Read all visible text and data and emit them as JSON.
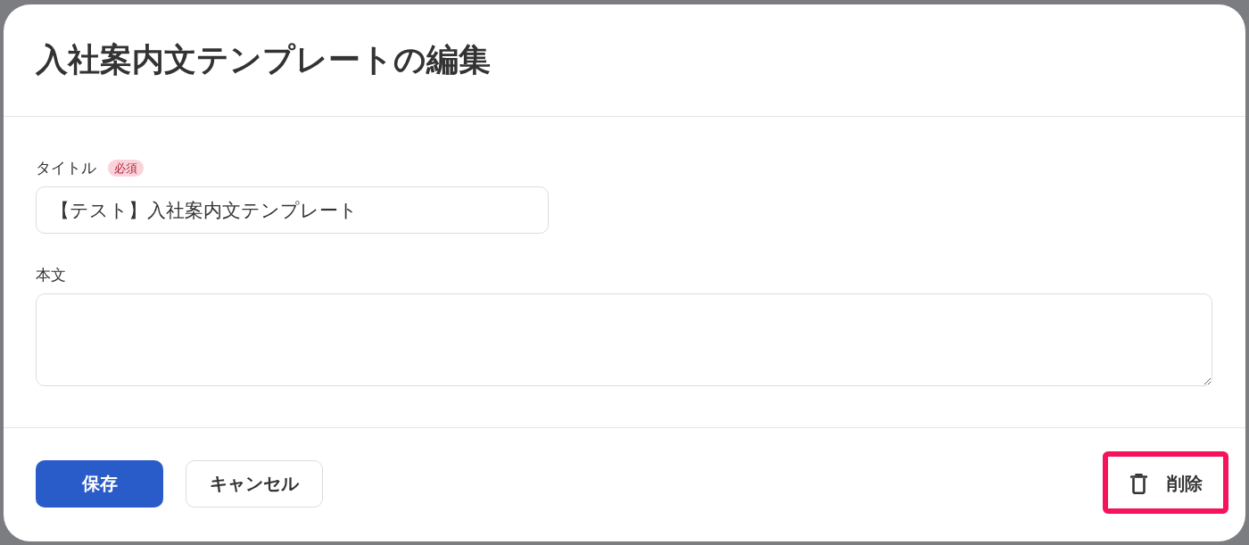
{
  "dialog": {
    "title": "入社案内文テンプレートの編集"
  },
  "fields": [
    {
      "kind": "input",
      "label": "タイトル",
      "badge": "必須",
      "value": "【テスト】入社案内文テンプレート"
    },
    {
      "kind": "textarea",
      "label": "本文"
    }
  ],
  "footer": {
    "buttons": [
      {
        "kind": "primary",
        "label": "保存",
        "highlighted": false
      },
      {
        "kind": "secondary",
        "label": "キャンセル",
        "highlighted": false
      },
      {
        "kind": "danger",
        "label": "削除",
        "highlighted": true
      }
    ]
  }
}
